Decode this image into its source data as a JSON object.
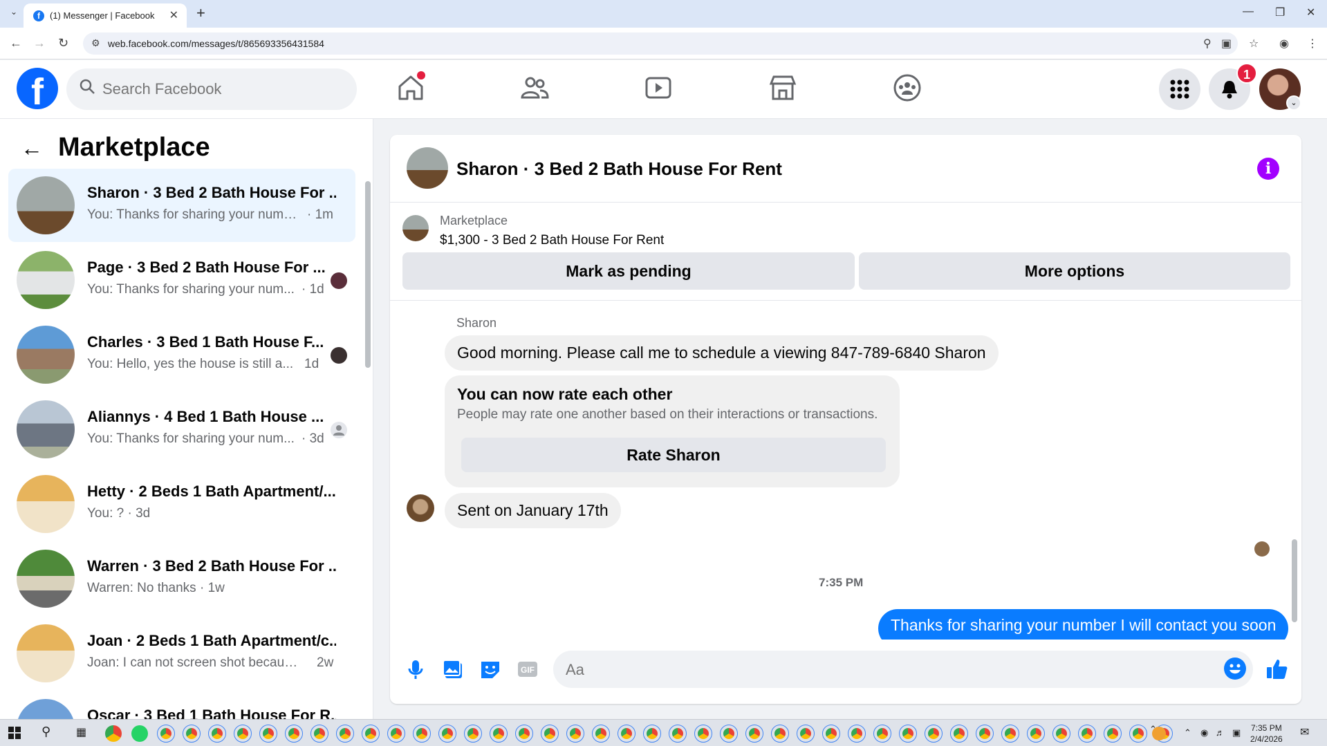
{
  "browser": {
    "tab_title": "(1) Messenger | Facebook",
    "url": "web.facebook.com/messages/t/865693356431584"
  },
  "header": {
    "search_placeholder": "Search Facebook",
    "notification_count": "1"
  },
  "left": {
    "title": "Marketplace",
    "conversations": [
      {
        "name": "Sharon · 3 Bed 2 Bath House For ...",
        "preview": "You: Thanks for sharing your numb...",
        "time": "· 1m"
      },
      {
        "name": "Page · 3 Bed 2 Bath House For ...",
        "preview": "You: Thanks for sharing your num...",
        "time": "· 1d"
      },
      {
        "name": "Charles · 3 Bed 1 Bath House F...",
        "preview": "You: Hello, yes the house is still a...",
        "time": "1d"
      },
      {
        "name": "Aliannys · 4 Bed 1 Bath House ...",
        "preview": "You: Thanks for sharing your num...",
        "time": "· 3d"
      },
      {
        "name": "Hetty · 2 Beds 1 Bath Apartment/...",
        "preview": "You: ? · 3d",
        "time": ""
      },
      {
        "name": "Warren · 3 Bed 2 Bath House For ...",
        "preview": "Warren: No thanks · 1w",
        "time": ""
      },
      {
        "name": "Joan · 2 Beds 1 Bath Apartment/c...",
        "preview": "Joan: I can not screen shot because ...",
        "time": "2w"
      },
      {
        "name": "Oscar · 3 Bed 1 Bath House For R...",
        "preview": "",
        "time": ""
      }
    ]
  },
  "chat": {
    "title": "Sharon · 3 Bed 2 Bath House For Rent",
    "listing_source": "Marketplace",
    "listing_title": "$1,300 - 3 Bed 2 Bath House For Rent",
    "btn_pending": "Mark as pending",
    "btn_more": "More options",
    "sender": "Sharon",
    "msg1": "Good morning.  Please call me to schedule a viewing 847-789-6840 Sharon",
    "card_title": "You can now rate each other",
    "card_sub": "People may rate one another based on their interactions or transactions.",
    "card_btn": "Rate Sharon",
    "msg2": "Sent on January 17th",
    "timestamp": "7:35 PM",
    "msg_out": "Thanks for sharing your number I will contact you soon",
    "composer_placeholder": "Aa"
  },
  "taskbar": {
    "time": "7:35 PM",
    "date": "2/4/2026"
  },
  "colors": {
    "fb_blue": "#0866ff",
    "outgoing_bubble": "#0a7cff",
    "active_row": "#ebf5ff",
    "badge_red": "#e41e3f",
    "info_purple": "#a200ff"
  }
}
